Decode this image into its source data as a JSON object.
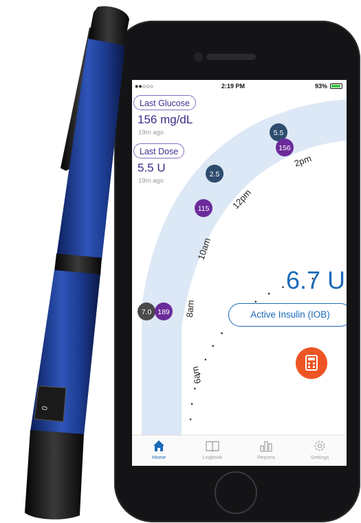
{
  "status_bar": {
    "signal": "●●○○○",
    "time": "2:19 PM",
    "battery_text": "93%",
    "battery_level": 0.93
  },
  "cards": {
    "last_glucose": {
      "label": "Last Glucose",
      "value": "156 mg/dL",
      "ago": "19m ago"
    },
    "last_dose": {
      "label": "Last Dose",
      "value": "5.5 U",
      "ago": "19m ago"
    }
  },
  "timeline": {
    "time_labels": [
      "2pm",
      "12pm",
      "10am",
      "8am",
      "6am"
    ],
    "markers": [
      {
        "text": "5.5",
        "kind": "dose"
      },
      {
        "text": "156",
        "kind": "glucose"
      },
      {
        "text": "2.5",
        "kind": "dose"
      },
      {
        "text": "115",
        "kind": "glucose"
      },
      {
        "text": "7.0",
        "kind": "dose"
      },
      {
        "text": "189",
        "kind": "glucose"
      }
    ]
  },
  "iob": {
    "value": "6.7 U",
    "label": "Active Insulin (IOB)"
  },
  "tabs": [
    {
      "label": "Home",
      "icon": "home-icon"
    },
    {
      "label": "Logbook",
      "icon": "book-icon"
    },
    {
      "label": "Reports",
      "icon": "chart-icon"
    },
    {
      "label": "Settings",
      "icon": "gear-icon"
    }
  ],
  "colors": {
    "dose": "#2e4d6e",
    "glucose": "#6b2b9a",
    "accent": "#1b6ab8",
    "calculator": "#ee5524",
    "arc": "#dce8f5"
  }
}
